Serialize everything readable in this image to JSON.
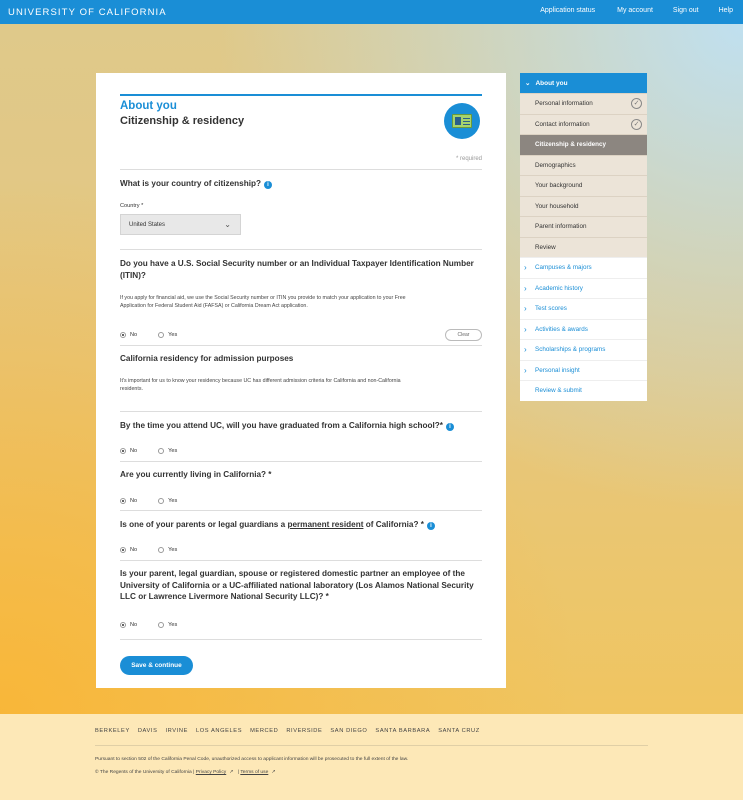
{
  "topbar": {
    "brand": "UNIVERSITY OF CALIFORNIA",
    "nav": [
      "Application status",
      "My account",
      "Sign out",
      "Help"
    ]
  },
  "form": {
    "section_title": "About you",
    "page_title": "Citizenship & residency",
    "required_note": "* required",
    "citizenship": {
      "question": "What is your country of citizenship?",
      "field_label": "Country *",
      "selected": "United States"
    },
    "ssn": {
      "question": "Do you have a U.S. Social Security number or an Individual Taxpayer Identification Number (ITIN)?",
      "help": "If you apply for financial aid, we use the Social Security number or ITIN you provide to match your application to your Free Application for Federal Student Aid (FAFSA) or California Dream Act application.",
      "no": "No",
      "yes": "Yes",
      "clear": "Clear"
    },
    "residency": {
      "heading": "California residency for admission purposes",
      "help": "It's important for us to know your residency because UC has different admission criteria for California and non-California residents."
    },
    "q_highschool": {
      "question": "By the time you attend UC, will you have graduated from a California high school?*",
      "no": "No",
      "yes": "Yes"
    },
    "q_living": {
      "question": "Are you currently living in California? *",
      "no": "No",
      "yes": "Yes"
    },
    "q_parents": {
      "question_pre": "Is one of your parents or legal guardians a ",
      "question_link": "permanent resident",
      "question_post": " of California? *",
      "no": "No",
      "yes": "Yes"
    },
    "q_employee": {
      "question": "Is your parent, legal guardian, spouse or registered domestic partner an employee of the University of California or a UC-affiliated national laboratory (Los Alamos National Security LLC or Lawrence Livermore National Security LLC)? *",
      "no": "No",
      "yes": "Yes"
    },
    "save_button": "Save & continue"
  },
  "sidebar": {
    "header": "About you",
    "subitems": [
      {
        "label": "Personal information",
        "done": true
      },
      {
        "label": "Contact information",
        "done": true
      },
      {
        "label": "Citizenship & residency",
        "active": true
      },
      {
        "label": "Demographics"
      },
      {
        "label": "Your background"
      },
      {
        "label": "Your household"
      },
      {
        "label": "Parent information"
      },
      {
        "label": "Review"
      }
    ],
    "sections": [
      "Campuses & majors",
      "Academic history",
      "Test scores",
      "Activities & awards",
      "Scholarships & programs",
      "Personal insight"
    ],
    "review_submit": "Review & submit"
  },
  "footer": {
    "campuses": [
      "BERKELEY",
      "DAVIS",
      "IRVINE",
      "LOS ANGELES",
      "MERCED",
      "RIVERSIDE",
      "SAN DIEGO",
      "SANTA BARBARA",
      "SANTA CRUZ"
    ],
    "legal": "Pursuant to section 502 of the California Penal Code, unauthorized access to applicant information will be prosecuted to the full extent of the law.",
    "copyright": "© The Regents of the University of California",
    "privacy": "Privacy Policy",
    "terms": "Terms of use"
  },
  "colors": {
    "primary": "#1a8ed6",
    "active_nav": "#8c8680",
    "footer_bg": "#fde8b7"
  }
}
